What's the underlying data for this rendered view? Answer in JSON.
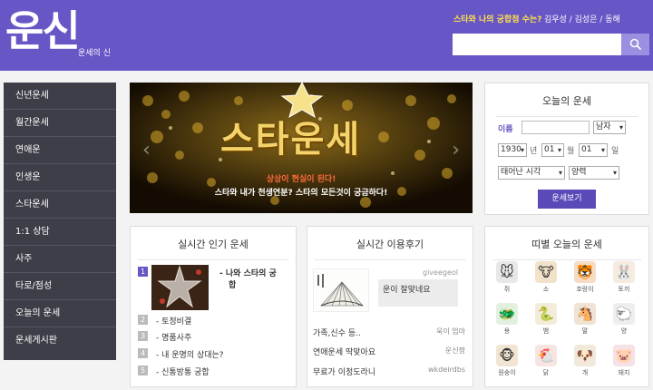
{
  "header": {
    "logo": "운신",
    "logo_sub": "운세의 신",
    "star_question": "스타와 나의 궁합점 수는?",
    "star_names": "김우성 / 김성은 / 동해",
    "search_placeholder": ""
  },
  "sidebar": {
    "items": [
      {
        "label": "신년운세"
      },
      {
        "label": "월간운세"
      },
      {
        "label": "연애운"
      },
      {
        "label": "인생운"
      },
      {
        "label": "스타운세"
      },
      {
        "label": "1:1 상담"
      },
      {
        "label": "사주"
      },
      {
        "label": "타로/점성"
      },
      {
        "label": "오늘의 운세"
      },
      {
        "label": "운세게시판"
      }
    ]
  },
  "banner": {
    "title": "스타운세",
    "line1": "상상이 현실이 된다!",
    "line2": "스타와 내가 천생연분? 스타의 모든것이 궁금하다!"
  },
  "fortune": {
    "title": "오늘의 운세",
    "name_label": "이름",
    "gender": "남자",
    "year": "1930",
    "year_unit": "년",
    "month": "01",
    "month_unit": "월",
    "day": "01",
    "day_unit": "일",
    "birth_time": "태어난 시각",
    "calendar": "양력",
    "submit": "운세보기"
  },
  "popular": {
    "title": "실시간 인기 운세",
    "items": [
      {
        "num": "1",
        "text": "나와 스타의 궁"
      },
      {
        "num": "2",
        "text": "토정비결"
      },
      {
        "num": "3",
        "text": "명품사주"
      },
      {
        "num": "4",
        "text": "내 운명의 상대는?"
      },
      {
        "num": "5",
        "text": "신통방통 궁합"
      }
    ],
    "first_line2": "합"
  },
  "reviews": {
    "title": "실시간 이용후기",
    "featured_author": "giveegeol",
    "featured_text": "운이 잘맞네요",
    "rows": [
      {
        "text": "가족,신수 등..",
        "who": "욱이 엄마"
      },
      {
        "text": "연애운세 딱맞아요",
        "who": "운신짱"
      },
      {
        "text": "무료가 이정도라니",
        "who": "wkdeirdbs"
      }
    ]
  },
  "zodiac": {
    "title": "띠별 오늘의 운세",
    "animals": [
      {
        "label": "쥐",
        "icon": "rat-icon",
        "color": "#e8e8e8"
      },
      {
        "label": "소",
        "icon": "ox-icon",
        "color": "#f2e2c9"
      },
      {
        "label": "호랑이",
        "icon": "tiger-icon",
        "color": "#f6dcc4"
      },
      {
        "label": "토끼",
        "icon": "rabbit-icon",
        "color": "#f5ece0"
      },
      {
        "label": "용",
        "icon": "dragon-icon",
        "color": "#e3f0e0"
      },
      {
        "label": "뱀",
        "icon": "snake-icon",
        "color": "#f3ecd9"
      },
      {
        "label": "말",
        "icon": "horse-icon",
        "color": "#efe3d4"
      },
      {
        "label": "양",
        "icon": "sheep-icon",
        "color": "#eeeeee"
      },
      {
        "label": "원숭이",
        "icon": "monkey-icon",
        "color": "#f2e4d2"
      },
      {
        "label": "닭",
        "icon": "rooster-icon",
        "color": "#f6e5e0"
      },
      {
        "label": "개",
        "icon": "dog-icon",
        "color": "#f1e9dc"
      },
      {
        "label": "돼지",
        "icon": "pig-icon",
        "color": "#f7e1e4"
      }
    ]
  }
}
